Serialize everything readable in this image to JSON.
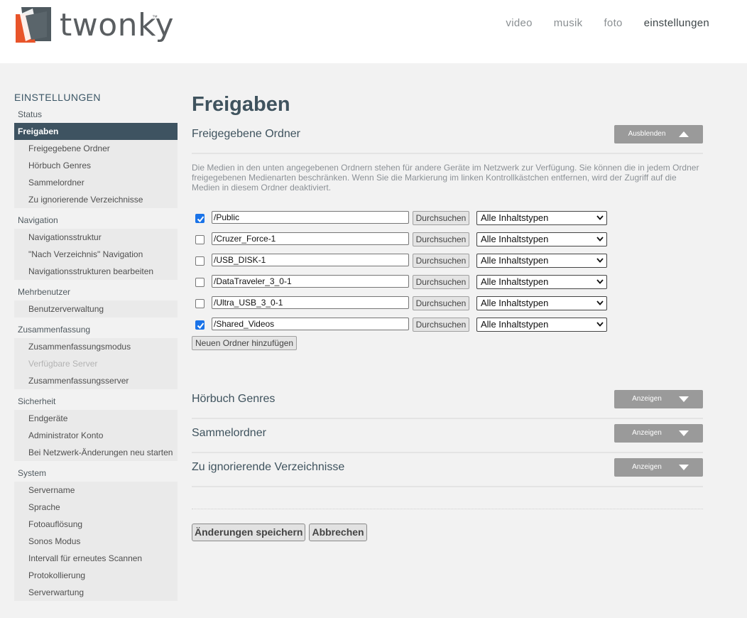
{
  "brand": {
    "logo_text": "twonky",
    "logo_tm": "™"
  },
  "topnav": [
    {
      "label": "video"
    },
    {
      "label": "musik"
    },
    {
      "label": "foto"
    },
    {
      "label": "einstellungen"
    }
  ],
  "sidebar": {
    "title": "EINSTELLUNGEN",
    "groups": [
      {
        "label": "Status",
        "items": []
      },
      {
        "label": "Freigaben",
        "active": true,
        "items": [
          "Freigegebene Ordner",
          "Hörbuch Genres",
          "Sammelordner",
          "Zu ignorierende Verzeichnisse"
        ]
      },
      {
        "label": "Navigation",
        "items": [
          "Navigationsstruktur",
          "\"Nach Verzeichnis\" Navigation",
          "Navigationsstrukturen bearbeiten"
        ]
      },
      {
        "label": "Mehrbenutzer",
        "items": [
          "Benutzerverwaltung"
        ]
      },
      {
        "label": "Zusammenfassung",
        "items": [
          "Zusammenfassungsmodus",
          "Verfügbare Server",
          "Zusammenfassungsserver"
        ]
      },
      {
        "label": "Sicherheit",
        "items": [
          "Endgeräte",
          "Administrator Konto",
          "Bei Netzwerk-Änderungen neu starten"
        ]
      },
      {
        "label": "System",
        "items": [
          "Servername",
          "Sprache",
          "Fotoauflösung",
          "Sonos Modus",
          "Intervall für erneutes Scannen",
          "Protokollierung",
          "Serverwartung"
        ]
      }
    ]
  },
  "main": {
    "title": "Freigaben",
    "shared": {
      "title": "Freigegebene Ordner",
      "toggle_label": "Ausblenden",
      "description": "Die Medien in den unten angegebenen Ordnern stehen für andere Geräte im Netzwerk zur Verfügung. Sie können die in jedem Ordner freigegebenen Medienarten beschränken. Wenn Sie die Markierung im linken Kontrollkästchen entfernen, wird der Zugriff auf die Medien in diesem Ordner deaktiviert.",
      "browse_label": "Durchsuchen",
      "folders": [
        {
          "path": "/Public",
          "checked": true,
          "type": "Alle Inhaltstypen"
        },
        {
          "path": "/Cruzer_Force-1",
          "checked": false,
          "type": "Alle Inhaltstypen"
        },
        {
          "path": "/USB_DISK-1",
          "checked": false,
          "type": "Alle Inhaltstypen"
        },
        {
          "path": "/DataTraveler_3_0-1",
          "checked": false,
          "type": "Alle Inhaltstypen"
        },
        {
          "path": "/Ultra_USB_3_0-1",
          "checked": false,
          "type": "Alle Inhaltstypen"
        },
        {
          "path": "/Shared_Videos",
          "checked": true,
          "type": "Alle Inhaltstypen"
        }
      ],
      "add_label": "Neuen Ordner hinzufügen"
    },
    "collapsed_sections": [
      {
        "title": "Hörbuch Genres",
        "toggle_label": "Anzeigen"
      },
      {
        "title": "Sammelordner",
        "toggle_label": "Anzeigen"
      },
      {
        "title": "Zu ignorierende Verzeichnisse",
        "toggle_label": "Anzeigen"
      }
    ],
    "save_label": "Änderungen speichern",
    "cancel_label": "Abbrechen"
  },
  "colors": {
    "accent": "#3e5361",
    "checkbox": "#1a73e8",
    "toggle": "#9a9a9a"
  }
}
